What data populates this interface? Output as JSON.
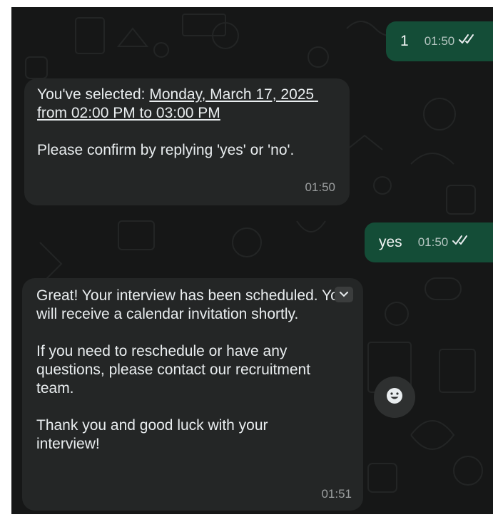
{
  "messages": {
    "m1": {
      "text": "1",
      "time": "01:50",
      "status": "read"
    },
    "m2": {
      "prefix": "You've selected: ",
      "link": "Monday, March 17, 2025 from 02:00 PM to 03:00 PM",
      "body": "Please confirm by replying 'yes' or 'no'.",
      "time": "01:50"
    },
    "m3": {
      "text": "yes",
      "time": "01:50",
      "status": "read"
    },
    "m4": {
      "p1": "Great! Your interview has been scheduled. You will receive a calendar invitation shortly.",
      "p2": "If you need to reschedule or have any questions, please contact our recruitment team.",
      "p3": "Thank you and good luck with your interview!",
      "time": "01:51"
    }
  },
  "icons": {
    "double_check": "double-check-icon",
    "chevron": "chevron-down-icon",
    "emoji": "smiley-icon"
  },
  "colors": {
    "background": "#161717",
    "outgoing_bubble": "#144d37",
    "incoming_bubble": "#242626",
    "text": "#e9edef",
    "read_ticks": "#e9edef"
  }
}
